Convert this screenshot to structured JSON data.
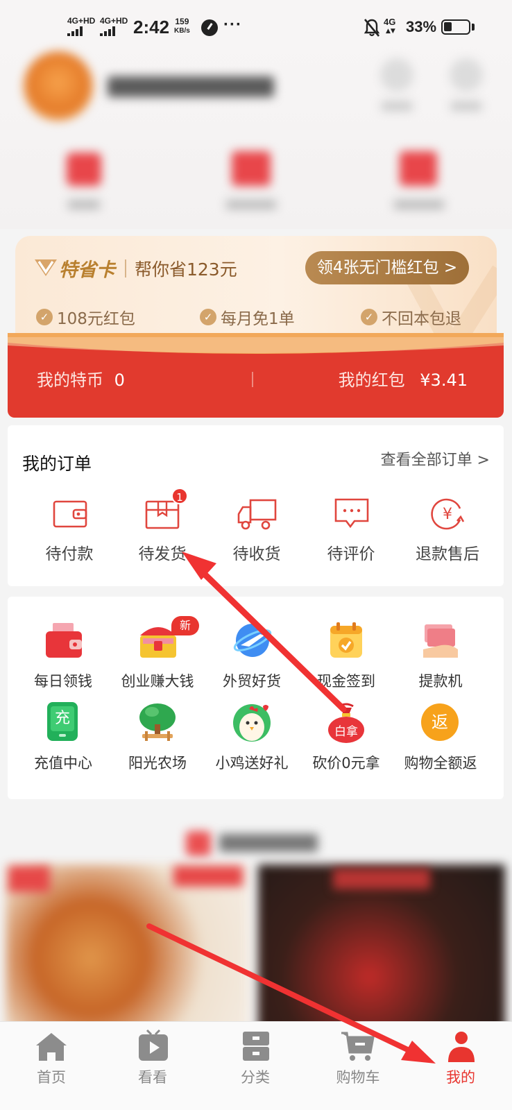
{
  "status_bar": {
    "sim1": "4G+HD",
    "sim2": "4G+HD",
    "time": "2:42",
    "speed_value": "159",
    "speed_unit": "KB/s",
    "more": "···",
    "network": "4G",
    "battery": "33%",
    "battery_level": 0.33
  },
  "vip": {
    "brand": "特省卡",
    "saving": "帮你省123元",
    "cta": "领4张无门槛红包 >",
    "benefits": [
      "108元红包",
      "每月免1单",
      "不回本包退"
    ]
  },
  "wallet": {
    "coins_label": "我的特币",
    "coins_value": "0",
    "redpacket_label": "我的红包",
    "redpacket_value": "¥3.41"
  },
  "orders": {
    "title": "我的订单",
    "view_all": "查看全部订单 >",
    "items": [
      {
        "label": "待付款",
        "icon": "wallet-icon"
      },
      {
        "label": "待发货",
        "icon": "package-icon",
        "badge": "1"
      },
      {
        "label": "待收货",
        "icon": "truck-icon"
      },
      {
        "label": "待评价",
        "icon": "comment-icon"
      },
      {
        "label": "退款售后",
        "icon": "refund-icon"
      }
    ]
  },
  "services": {
    "new_badge": "新",
    "items": [
      {
        "label": "每日领钱",
        "icon": "red-wallet-icon"
      },
      {
        "label": "创业赚大钱",
        "icon": "treasure-chest-icon"
      },
      {
        "label": "外贸好货",
        "icon": "globe-plane-icon"
      },
      {
        "label": "现金签到",
        "icon": "calendar-check-icon"
      },
      {
        "label": "提款机",
        "icon": "cash-hand-icon"
      },
      {
        "label": "充值中心",
        "icon": "phone-recharge-icon",
        "glyph": "充"
      },
      {
        "label": "阳光农场",
        "icon": "tree-icon"
      },
      {
        "label": "小鸡送好礼",
        "icon": "chick-icon"
      },
      {
        "label": "砍价0元拿",
        "icon": "money-bag-icon",
        "glyph": "白拿"
      },
      {
        "label": "购物全额返",
        "icon": "rebate-icon",
        "glyph": "返"
      }
    ]
  },
  "tabbar": {
    "items": [
      {
        "label": "首页",
        "icon": "home-icon"
      },
      {
        "label": "看看",
        "icon": "play-icon"
      },
      {
        "label": "分类",
        "icon": "category-icon"
      },
      {
        "label": "购物车",
        "icon": "cart-icon"
      },
      {
        "label": "我的",
        "icon": "profile-icon"
      }
    ]
  },
  "colors": {
    "brand_red": "#e13a2e",
    "gold": "#b9802f",
    "annotation_arrow": "#f03232"
  }
}
